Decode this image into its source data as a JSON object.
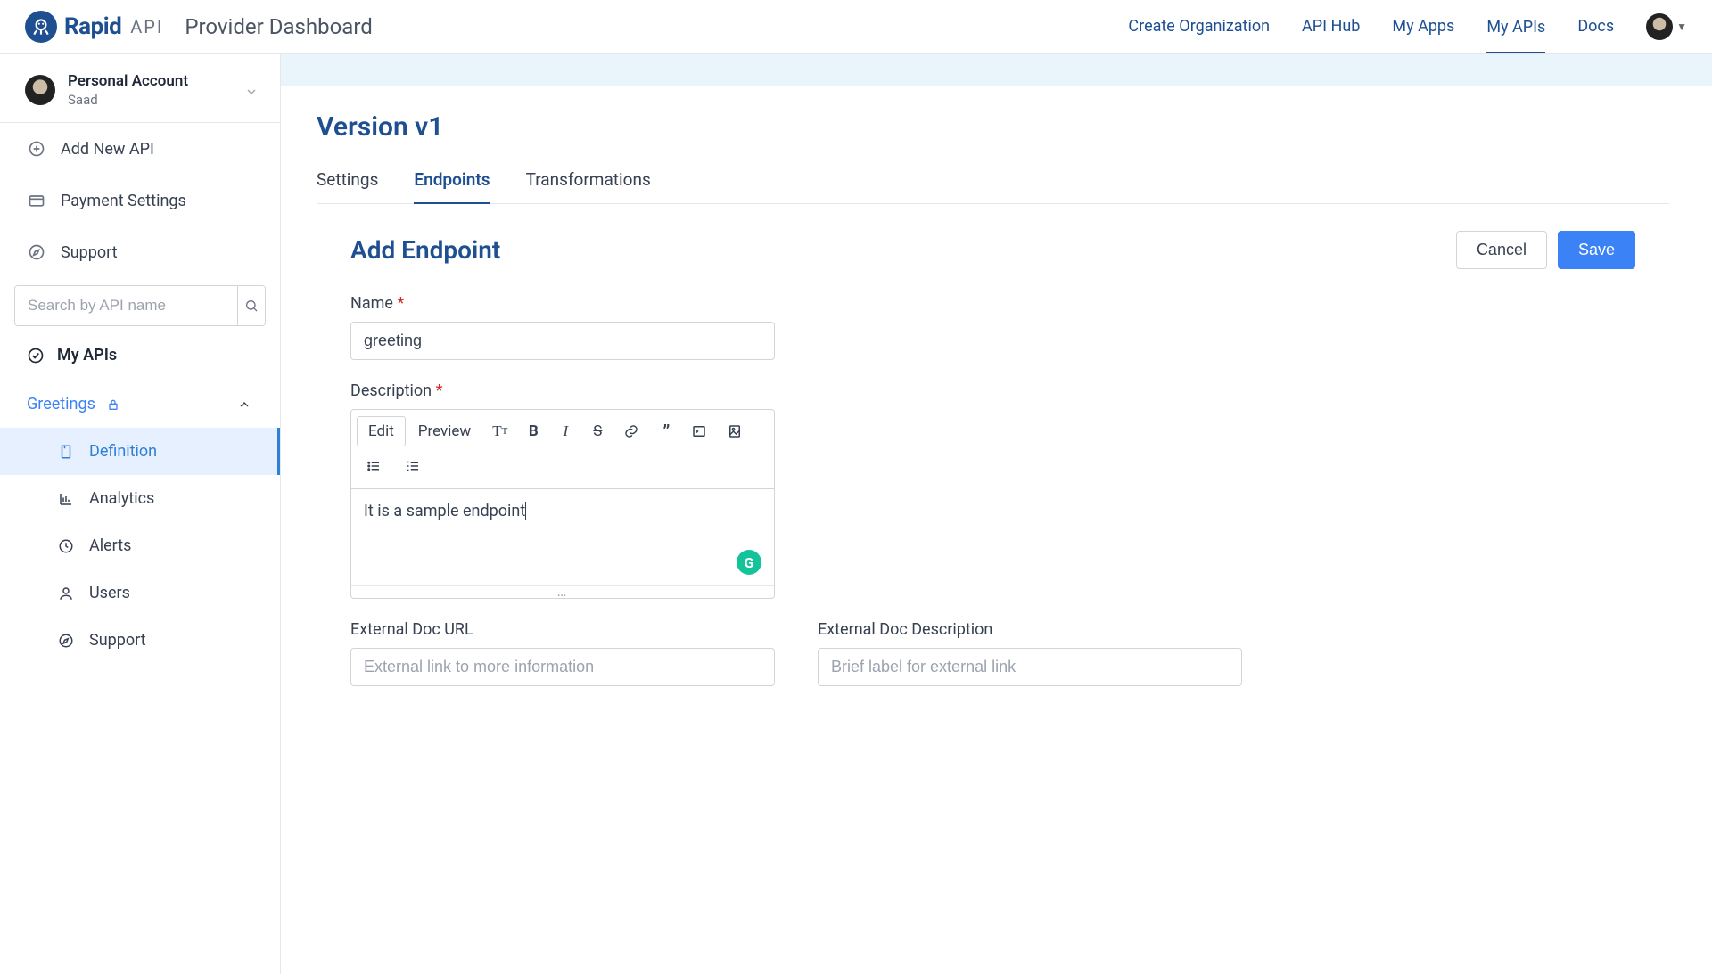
{
  "header": {
    "brand_word1": "Rapid",
    "brand_word2": "API",
    "subtitle": "Provider Dashboard",
    "nav": [
      {
        "label": "Create Organization",
        "active": false
      },
      {
        "label": "API Hub",
        "active": false
      },
      {
        "label": "My Apps",
        "active": false
      },
      {
        "label": "My APIs",
        "active": true
      },
      {
        "label": "Docs",
        "active": false
      }
    ]
  },
  "account": {
    "title": "Personal Account",
    "name": "Saad"
  },
  "sidebar": {
    "add_api": "Add New API",
    "payment": "Payment Settings",
    "support": "Support",
    "search_placeholder": "Search by API name",
    "my_apis": "My APIs",
    "api_name": "Greetings",
    "items": {
      "definition": "Definition",
      "analytics": "Analytics",
      "alerts": "Alerts",
      "users": "Users",
      "support": "Support"
    }
  },
  "main": {
    "version_title": "Version v1",
    "tabs": {
      "settings": "Settings",
      "endpoints": "Endpoints",
      "transformations": "Transformations"
    },
    "section_title": "Add Endpoint",
    "buttons": {
      "cancel": "Cancel",
      "save": "Save"
    },
    "fields": {
      "name_label": "Name",
      "name_value": "greeting",
      "description_label": "Description",
      "description_value": "It is a sample endpoint",
      "ext_url_label": "External Doc URL",
      "ext_url_placeholder": "External link to more information",
      "ext_desc_label": "External Doc Description",
      "ext_desc_placeholder": "Brief label for external link"
    },
    "editor_toolbar": {
      "edit": "Edit",
      "preview": "Preview"
    }
  }
}
